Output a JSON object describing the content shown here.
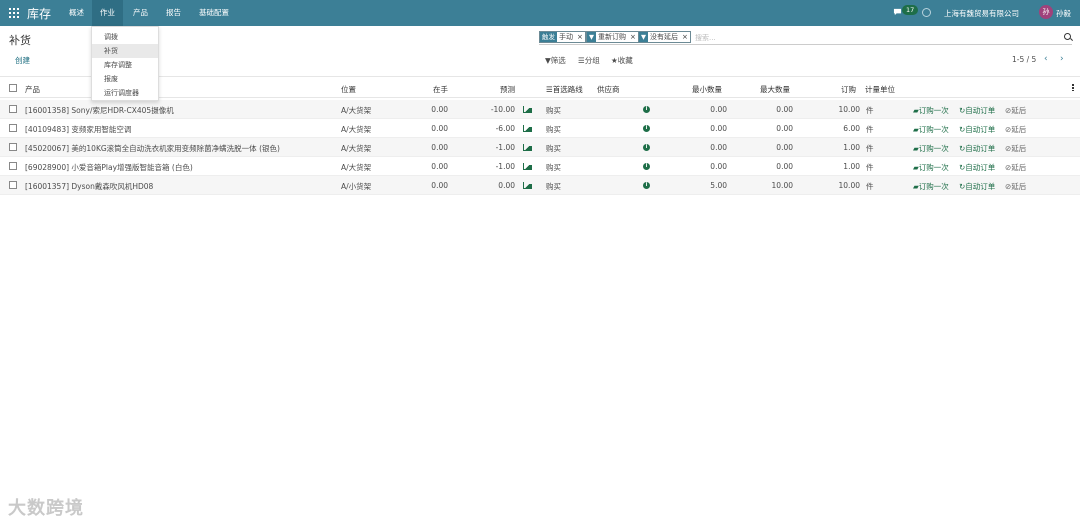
{
  "navbar": {
    "brand": "库存",
    "menu": [
      "概述",
      "作业",
      "产品",
      "报告",
      "基础配置"
    ],
    "chat_count": "17",
    "company": "上海有魏贸易有限公司",
    "avatar_char": "孙",
    "user": "孙毅"
  },
  "dropdown": [
    "调拨",
    "补货",
    "库存调整",
    "报废",
    "运行调度器"
  ],
  "control": {
    "title": "补货",
    "create": "创建",
    "facets": [
      {
        "tag": "触发",
        "value": "手动"
      },
      {
        "tag": "",
        "value": "重新订购"
      },
      {
        "tag": "",
        "value": "没有延后"
      }
    ],
    "search_placeholder": "搜索...",
    "filter": "筛选",
    "group": "分组",
    "favorite": "收藏",
    "pager": "1-5 / 5"
  },
  "table": {
    "headers": [
      "产品",
      "位置",
      "在手",
      "预测",
      "首选路线",
      "供应商",
      "最小数量",
      "最大数量",
      "订购",
      "计量单位"
    ],
    "rows": [
      {
        "product": "[16001358] Sony/索尼HDR-CX405摄像机",
        "location": "A/大货架",
        "onhand": "0.00",
        "forecast": "-10.00",
        "route": "购买",
        "min": "0.00",
        "max": "0.00",
        "order": "10.00",
        "uom": "件"
      },
      {
        "product": "[40109483] 变频家用智能空调",
        "location": "A/大货架",
        "onhand": "0.00",
        "forecast": "-6.00",
        "route": "购买",
        "min": "0.00",
        "max": "0.00",
        "order": "6.00",
        "uom": "件"
      },
      {
        "product": "[45020067] 美的10KG滚筒全自动洗衣机家用变频除菌净螨洗脱一体 (银色)",
        "location": "A/大货架",
        "onhand": "0.00",
        "forecast": "-1.00",
        "route": "购买",
        "min": "0.00",
        "max": "0.00",
        "order": "1.00",
        "uom": "件"
      },
      {
        "product": "[69028900] 小爱音箱Play增强版智能音箱 (白色)",
        "location": "A/大货架",
        "onhand": "0.00",
        "forecast": "-1.00",
        "route": "购买",
        "min": "0.00",
        "max": "0.00",
        "order": "1.00",
        "uom": "件"
      },
      {
        "product": "[16001357] Dyson戴森吹风机HD08",
        "location": "A/小货架",
        "onhand": "0.00",
        "forecast": "0.00",
        "route": "购买",
        "min": "5.00",
        "max": "10.00",
        "order": "10.00",
        "uom": "件"
      }
    ],
    "actions": {
      "order_once": "订购一次",
      "auto_order": "自动订单",
      "snooze": "延后"
    }
  },
  "watermark": "大数跨境",
  "colors": {
    "navbar": "#3c7f96",
    "accent_green": "#1e6e48",
    "avatar": "#a0427b"
  }
}
